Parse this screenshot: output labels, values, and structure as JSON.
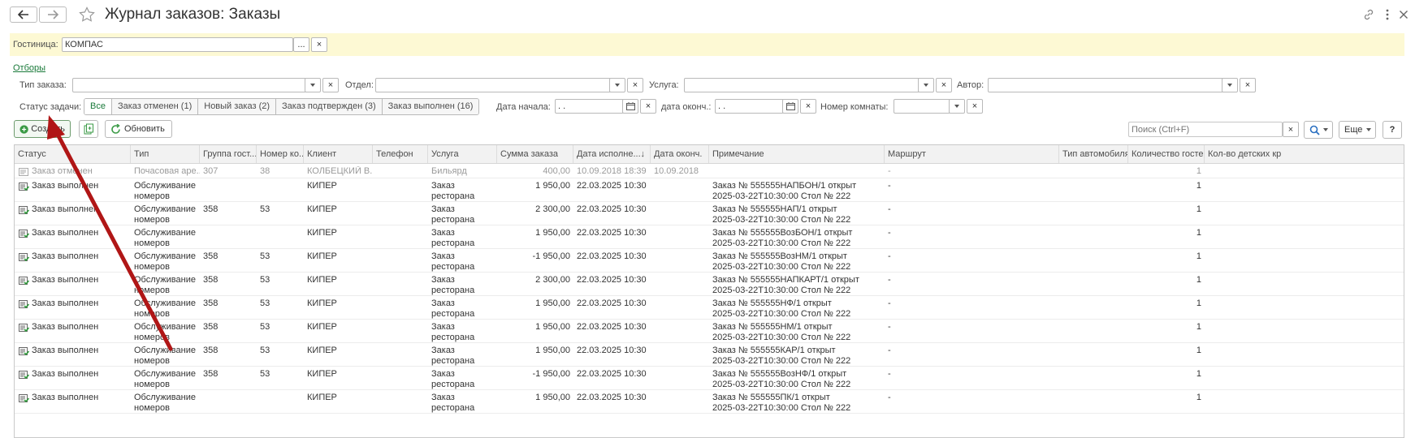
{
  "header": {
    "title": "Журнал заказов: Заказы"
  },
  "hotel": {
    "label": "Гостиница:",
    "value": "КОМПАС",
    "select_btn": "...",
    "clear_btn": "×"
  },
  "filters": {
    "link": "Отборы",
    "order_type_label": "Тип заказа:",
    "department_label": "Отдел:",
    "service_label": "Услуга:",
    "author_label": "Автор:",
    "task_status_label": "Статус задачи:",
    "status_segments": [
      "Все",
      "Заказ отменен (1)",
      "Новый заказ (2)",
      "Заказ подтвержден (3)",
      "Заказ выполнен (16)"
    ],
    "start_date_label": "Дата начала:",
    "start_date_value": " .  .",
    "end_date_label": "дата оконч.:",
    "end_date_value": " .  .",
    "room_label": "Номер комнаты:"
  },
  "toolbar": {
    "create_label": "Создать",
    "refresh_label": "Обновить",
    "search_placeholder": "Поиск (Ctrl+F)",
    "more_label": "Еще",
    "help_label": "?"
  },
  "table": {
    "columns": [
      "Статус",
      "Тип",
      "Группа гост...",
      "Номер ко...",
      "Клиент",
      "Телефон",
      "Услуга",
      "Сумма заказа",
      "Дата исполне...",
      "Дата оконч.",
      "Примечание",
      "Маршрут",
      "Тип автомобиля",
      "Количество гостей",
      "Кол-во детских кр"
    ],
    "sort_indicator": "↓",
    "rows": [
      {
        "status": "Заказ отменен",
        "type1": "Почасовая аре...",
        "type2": "",
        "group": "307",
        "room": "38",
        "client": "КОЛБЕЦКИЙ В.",
        "service1": "Бильярд",
        "service2": "",
        "sum": "400,00",
        "date": "10.09.2018 18:39",
        "end": "10.09.2018",
        "note1": "",
        "note2": "",
        "route": "-",
        "guests": "1",
        "cancelled": true
      },
      {
        "status": "Заказ выполнен",
        "type1": "Обслуживание",
        "type2": "номеров",
        "group": "",
        "room": "",
        "client": "КИПЕР",
        "service1": "Заказ",
        "service2": "ресторана",
        "sum": "1 950,00",
        "date": "22.03.2025 10:30",
        "end": "",
        "note1": "Заказ № 555555НАПБОН/1 открыт",
        "note2": "2025-03-22T10:30:00 Стол № 222",
        "route": "-",
        "guests": "1"
      },
      {
        "status": "Заказ выполнен",
        "type1": "Обслуживание",
        "type2": "номеров",
        "group": "358",
        "room": "53",
        "client": "КИПЕР",
        "service1": "Заказ",
        "service2": "ресторана",
        "sum": "2 300,00",
        "date": "22.03.2025 10:30",
        "end": "",
        "note1": "Заказ № 555555НАП/1 открыт",
        "note2": "2025-03-22T10:30:00 Стол № 222",
        "route": "-",
        "guests": "1"
      },
      {
        "status": "Заказ выполнен",
        "type1": "Обслуживание",
        "type2": "номеров",
        "group": "",
        "room": "",
        "client": "КИПЕР",
        "service1": "Заказ",
        "service2": "ресторана",
        "sum": "1 950,00",
        "date": "22.03.2025 10:30",
        "end": "",
        "note1": "Заказ № 555555ВозБОН/1 открыт",
        "note2": "2025-03-22T10:30:00 Стол № 222",
        "route": "-",
        "guests": "1"
      },
      {
        "status": "Заказ выполнен",
        "type1": "Обслуживание",
        "type2": "номеров",
        "group": "358",
        "room": "53",
        "client": "КИПЕР",
        "service1": "Заказ",
        "service2": "ресторана",
        "sum": "-1 950,00",
        "date": "22.03.2025 10:30",
        "end": "",
        "note1": "Заказ № 555555ВозНМ/1 открыт",
        "note2": "2025-03-22T10:30:00 Стол № 222",
        "route": "-",
        "guests": "1"
      },
      {
        "status": "Заказ выполнен",
        "type1": "Обслуживание",
        "type2": "номеров",
        "group": "358",
        "room": "53",
        "client": "КИПЕР",
        "service1": "Заказ",
        "service2": "ресторана",
        "sum": "2 300,00",
        "date": "22.03.2025 10:30",
        "end": "",
        "note1": "Заказ № 555555НАПКАРТ/1 открыт",
        "note2": "2025-03-22T10:30:00 Стол № 222",
        "route": "-",
        "guests": "1"
      },
      {
        "status": "Заказ выполнен",
        "type1": "Обслуживание",
        "type2": "номеров",
        "group": "358",
        "room": "53",
        "client": "КИПЕР",
        "service1": "Заказ",
        "service2": "ресторана",
        "sum": "1 950,00",
        "date": "22.03.2025 10:30",
        "end": "",
        "note1": "Заказ № 555555НФ/1 открыт",
        "note2": "2025-03-22T10:30:00 Стол № 222",
        "route": "-",
        "guests": "1"
      },
      {
        "status": "Заказ выполнен",
        "type1": "Обслуживание",
        "type2": "номеров",
        "group": "358",
        "room": "53",
        "client": "КИПЕР",
        "service1": "Заказ",
        "service2": "ресторана",
        "sum": "1 950,00",
        "date": "22.03.2025 10:30",
        "end": "",
        "note1": "Заказ № 555555НМ/1 открыт",
        "note2": "2025-03-22T10:30:00 Стол № 222",
        "route": "-",
        "guests": "1"
      },
      {
        "status": "Заказ выполнен",
        "type1": "Обслуживание",
        "type2": "номеров",
        "group": "358",
        "room": "53",
        "client": "КИПЕР",
        "service1": "Заказ",
        "service2": "ресторана",
        "sum": "1 950,00",
        "date": "22.03.2025 10:30",
        "end": "",
        "note1": "Заказ № 555555КАР/1 открыт",
        "note2": "2025-03-22T10:30:00 Стол № 222",
        "route": "-",
        "guests": "1"
      },
      {
        "status": "Заказ выполнен",
        "type1": "Обслуживание",
        "type2": "номеров",
        "group": "358",
        "room": "53",
        "client": "КИПЕР",
        "service1": "Заказ",
        "service2": "ресторана",
        "sum": "-1 950,00",
        "date": "22.03.2025 10:30",
        "end": "",
        "note1": "Заказ № 555555ВозНФ/1 открыт",
        "note2": "2025-03-22T10:30:00 Стол № 222",
        "route": "-",
        "guests": "1"
      },
      {
        "status": "Заказ выполнен",
        "type1": "Обслуживание",
        "type2": "номеров",
        "group": "",
        "room": "",
        "client": "КИПЕР",
        "service1": "Заказ",
        "service2": "ресторана",
        "sum": "1 950,00",
        "date": "22.03.2025 10:30",
        "end": "",
        "note1": "Заказ № 555555ПК/1 открыт",
        "note2": "2025-03-22T10:30:00 Стол № 222",
        "route": "-",
        "guests": "1"
      }
    ]
  },
  "colors": {
    "accent_green": "#1a7a3a",
    "hotel_bar_bg": "#fdf9d4",
    "annotation_arrow": "#b01616"
  }
}
